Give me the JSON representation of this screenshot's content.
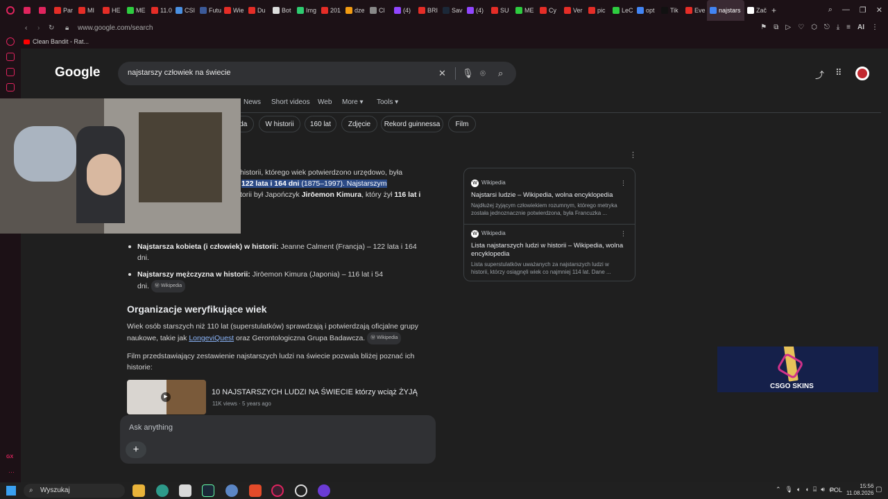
{
  "browser": {
    "tabs": [
      "",
      "",
      "Par",
      "MI",
      "HE",
      "ME",
      "11.0",
      "CSI",
      "Futu",
      "Wie",
      "Du",
      "Bot",
      "Img",
      "201",
      "dze",
      "Cl",
      "(4)",
      "BRI",
      "Sav",
      "(4)",
      "SU",
      "ME",
      "Cy",
      "Ver",
      "pic",
      "LeC",
      "opt",
      "Tik",
      "Eve",
      "najstars",
      "Zač"
    ],
    "active_tab_index": 29,
    "url": "www.google.com/search",
    "bookmark": "Clean Bandit - Rat...",
    "ai_label": "AI"
  },
  "google": {
    "logo": "Google",
    "query": "najstarszy człowiek na świecie",
    "filters": [
      "News",
      "Short videos",
      "Web",
      "More ▾",
      "Tools ▾"
    ],
    "chips": [
      "ąda",
      "W historii",
      "160 lat",
      "Zdjęcie",
      "Rekord guinnessa",
      "Film"
    ],
    "overview": {
      "line1": "historii, którego wiek potwierdzono urzędowo, była",
      "line2_hl_bold": "122 lata i 164 dni",
      "line2_hl_rest": " (1875–1997). Najstarszym",
      "line3_a": "torii był Japończyk ",
      "line3_b": "Jirōemon Kimura",
      "line3_c": ", który żył ",
      "line3_d": "116 lat i",
      "bullet1_bold": "Najstarsza kobieta (i człowiek) w historii:",
      "bullet1_rest": " Jeanne Calment (Francja) – 122 lata i 164",
      "bullet1_cont": "dni.",
      "bullet2_bold": "Najstarszy mężczyzna w historii:",
      "bullet2_rest": " Jirōemon Kimura (Japonia) – 116 lat i 54",
      "bullet2_cont": "dni.",
      "wiki_tag": "Wikipedia",
      "heading2": "Organizacje weryfikujące wiek",
      "para1_l1": "Wiek osób starszych niż 110 lat (superstulatków) sprawdzają i potwierdzają oficjalne grupy",
      "para1_l2_a": "naukowe, takie jak ",
      "para1_link": "LongeviQuest",
      "para1_l2_b": " oraz Gerontologiczna Grupa Badawcza.",
      "para2_l1": "Film przedstawiający zestawienie najstarszych ludzi na świecie pozwala bliżej poznać ich",
      "para2_l2": "historie:"
    },
    "video": {
      "title": "10 NAJSTARSZYCH LUDZI NA ŚWIECIE którzy wciąż ŻYJĄ",
      "meta": "11K views · 5 years ago"
    },
    "side_cards": [
      {
        "source": "Wikipedia",
        "title": "Najstarsi ludzie – Wikipedia, wolna encyklopedia",
        "desc_l1": "Najdłużej żyjącym człowiekiem rozumnym, którego metryka",
        "desc_l2": "została jednoznacznie potwierdzona, była Francuzka ..."
      },
      {
        "source": "Wikipedia",
        "title_l1": "Lista najstarszych ludzi w historii – Wikipedia, wolna",
        "title_l2": "encyklopedia",
        "desc_l1": "Lista superstulatków uważanych za najstarszych ludzi w",
        "desc_l2": "historii, którzy osiągnęli wiek co najmniej 114 lat. Dane ..."
      }
    ],
    "ask_placeholder": "Ask anything",
    "ask_plus": "+"
  },
  "overlay": {
    "csgo_text": "CSGO SKINS"
  },
  "taskbar": {
    "search_label": "Wyszukaj",
    "lang": "POL",
    "time": "15:56",
    "date": "11.08.2026"
  },
  "icons": {
    "accent": "#e0245e",
    "link": "#8ab4f8",
    "highlight": "#2b4a86"
  }
}
